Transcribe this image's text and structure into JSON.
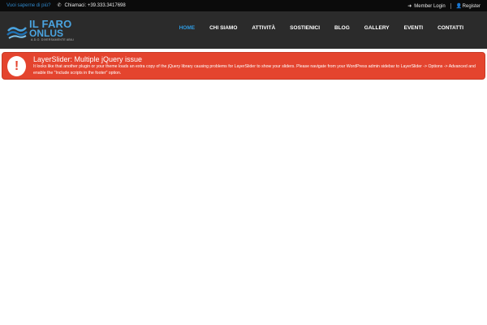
{
  "topbar": {
    "more_link": "Vuoi saperne di più?",
    "phone_icon": "phone-icon",
    "phone_text": "Chiamaci: +39.333.3417698",
    "member_login_icon": "login-icon",
    "member_login": "Member Login",
    "register_icon": "user-icon",
    "register": "Register"
  },
  "brand": {
    "line1": "IL FARO",
    "line2": "ONLUS",
    "tagline": "A.D.O. DIVERSAMENTE ABILI",
    "accent": "#4aa3df"
  },
  "nav": {
    "items": [
      {
        "label": "HOME",
        "active": true
      },
      {
        "label": "CHI SIAMO",
        "active": false
      },
      {
        "label": "ATTIVITÀ",
        "active": false
      },
      {
        "label": "SOSTIENICI",
        "active": false
      },
      {
        "label": "BLOG",
        "active": false
      },
      {
        "label": "GALLERY",
        "active": false
      },
      {
        "label": "EVENTI",
        "active": false
      },
      {
        "label": "CONTATTI",
        "active": false
      }
    ],
    "active_color": "#2f9ae0"
  },
  "alert": {
    "icon": "exclamation-icon",
    "title": "LayerSlider: Multiple jQuery issue",
    "message": "It looks like that another plugin or your theme loads an extra copy of the jQuery library causing problems for LayerSlider to show your sliders. Please navigate from your WordPress admin sidebar to LayerSlider -> Options -> Advanced and enable the \"Include scripts in the footer\" option.",
    "color": "#e4442e"
  }
}
